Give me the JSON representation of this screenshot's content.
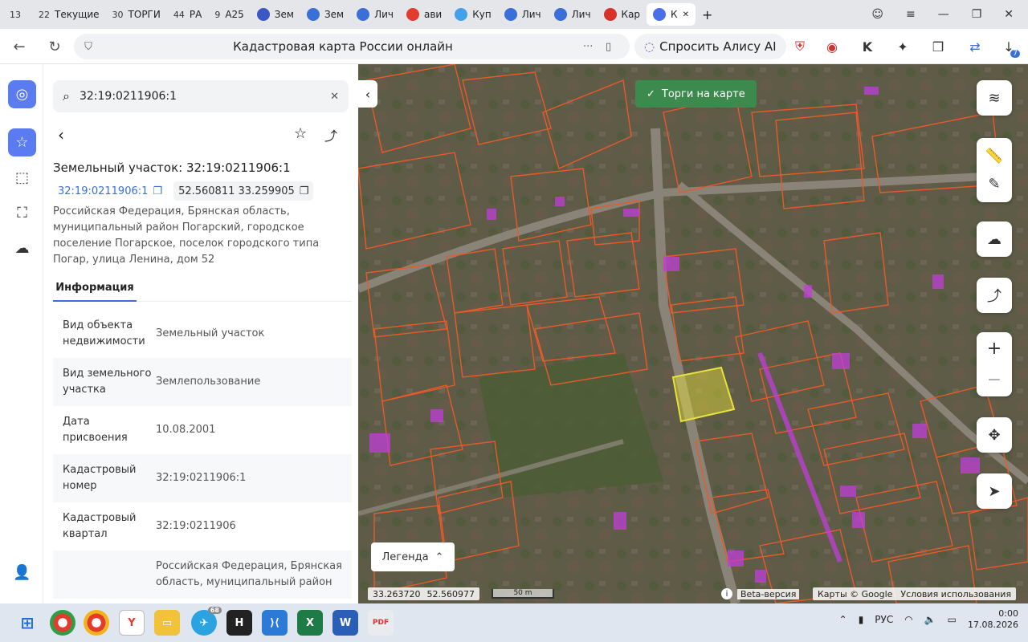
{
  "browser": {
    "tabs": [
      {
        "num": "13",
        "label": "",
        "color": ""
      },
      {
        "num": "22",
        "label": "Текущие",
        "color": ""
      },
      {
        "num": "30",
        "label": "ТОРГИ",
        "color": ""
      },
      {
        "num": "44",
        "label": "РА",
        "color": ""
      },
      {
        "num": "9",
        "label": "А25",
        "color": ""
      },
      {
        "num": "",
        "label": "Зем",
        "color": "#3a57c4"
      },
      {
        "num": "",
        "label": "Зем",
        "color": "#3a6fd8"
      },
      {
        "num": "",
        "label": "Лич",
        "color": "#3a6fd8"
      },
      {
        "num": "",
        "label": "ави",
        "color": "#e43b2f"
      },
      {
        "num": "",
        "label": "Куп",
        "color": "#44a0e8"
      },
      {
        "num": "",
        "label": "Лич",
        "color": "#3a6fd8"
      },
      {
        "num": "",
        "label": "Лич",
        "color": "#3a6fd8"
      },
      {
        "num": "",
        "label": "Кар",
        "color": "#d6332a"
      },
      {
        "num": "",
        "label": "К",
        "color": "#4a6fe8"
      }
    ],
    "page_title": "Кадастровая карта России онлайн",
    "alice_label": "Спросить Алису AI",
    "download_badge": "7"
  },
  "sidebar": {
    "search_value": "32:19:0211906:1",
    "title": "Земельный участок: 32:19:0211906:1",
    "cad_link": "32:19:0211906:1",
    "coords_chip": "52.560811 33.259905",
    "address": "Российская Федерация, Брянская область, муниципальный район Погарский, городское поселение Погарское, поселок городского типа Погар, улица Ленина, дом 52",
    "tab_info": "Информация",
    "rows": [
      {
        "k": "Вид объекта недвижимости",
        "v": "Земельный участок"
      },
      {
        "k": "Вид земельного участка",
        "v": "Землепользование"
      },
      {
        "k": "Дата присвоения",
        "v": "10.08.2001"
      },
      {
        "k": "Кадастровый номер",
        "v": "32:19:0211906:1"
      },
      {
        "k": "Кадастровый квартал",
        "v": "32:19:0211906"
      },
      {
        "k": "",
        "v": "Российская Федерация, Брянская область, муниципальный район"
      }
    ]
  },
  "map": {
    "torgi_label": "Торги на карте",
    "legend_label": "Легенда",
    "cursor_lon": "33.263720",
    "cursor_lat": "52.560977",
    "scale_label": "50 m",
    "beta_label": "Beta-версия",
    "attribution": "Карты © Google",
    "terms": "Условия использования",
    "colors": {
      "parcel": "#e85a2a",
      "selected": "#e8e23a",
      "zone": "#c03ed8"
    }
  },
  "taskbar": {
    "lang": "РУС",
    "time": "0:00",
    "date": "17.08.2026",
    "telegram_badge": "68"
  }
}
